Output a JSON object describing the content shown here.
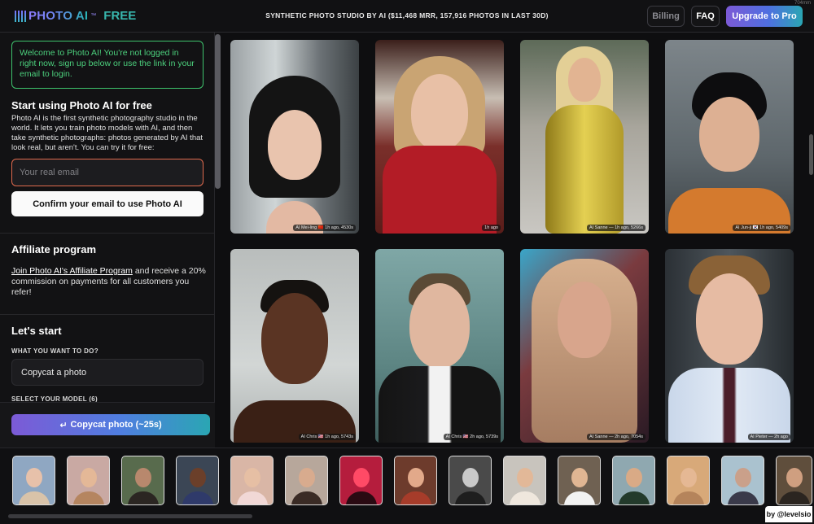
{
  "header": {
    "logo_text": "PHOTO AI",
    "logo_tm": "™",
    "logo_badge": "FREE",
    "tagline": "SYNTHETIC PHOTO STUDIO BY AI ($11,468 MRR, 157,916 PHOTOS IN LAST 30D)",
    "billing_label": "Billing",
    "faq_label": "FAQ",
    "upgrade_label": "Upgrade to Pro",
    "corner_label": "704mm"
  },
  "sidebar": {
    "welcome": "Welcome to Photo AI! You're not logged in right now, sign up below or use the link in your email to login.",
    "start_title": "Start using Photo AI for free",
    "intro": "Photo AI is the first synthetic photography studio in the world. It lets you train photo models with AI, and then take synthetic photographs: photos generated by AI that look real, but aren't. You can try it for free:",
    "email_placeholder": "Your real email",
    "confirm_label": "Confirm your email to use Photo AI",
    "affiliate_title": "Affiliate program",
    "affiliate_link": "Join Photo AI's Affiliate Program",
    "affiliate_text": " and receive a 20% commission on payments for all customers you refer!",
    "lets_start_title": "Let's start",
    "what_label": "WHAT YOU WANT TO DO?",
    "what_value": "Copycat a photo",
    "model_label": "SELECT YOUR MODEL (6)",
    "copycat_label": "Copycat photo (~25s)",
    "copycat_icon": "return-arrow-icon"
  },
  "gallery": [
    {
      "caption": "AI Mei-ling 🇨🇳 1h ago, 4530s"
    },
    {
      "caption": "1h ago"
    },
    {
      "caption": "AI Sanne — 1h ago, 5266s"
    },
    {
      "caption": "AI Jun-ji 🇰🇷 1h ago, 5409s"
    },
    {
      "caption": "AI Chris 🇺🇸 1h ago, 5743s"
    },
    {
      "caption": "AI Chris 🇺🇸 2h ago, 5739s"
    },
    {
      "caption": "AI Sanne — 2h ago, 7054s"
    },
    {
      "caption": "AI Pieter — 2h ago"
    }
  ],
  "footer": {
    "byline": "by @levelsio"
  },
  "colors": {
    "accent_purple": "#7c5ad6",
    "accent_teal": "#2aa6b3",
    "welcome_green": "#4cd07d",
    "email_border": "#e06a4d"
  }
}
